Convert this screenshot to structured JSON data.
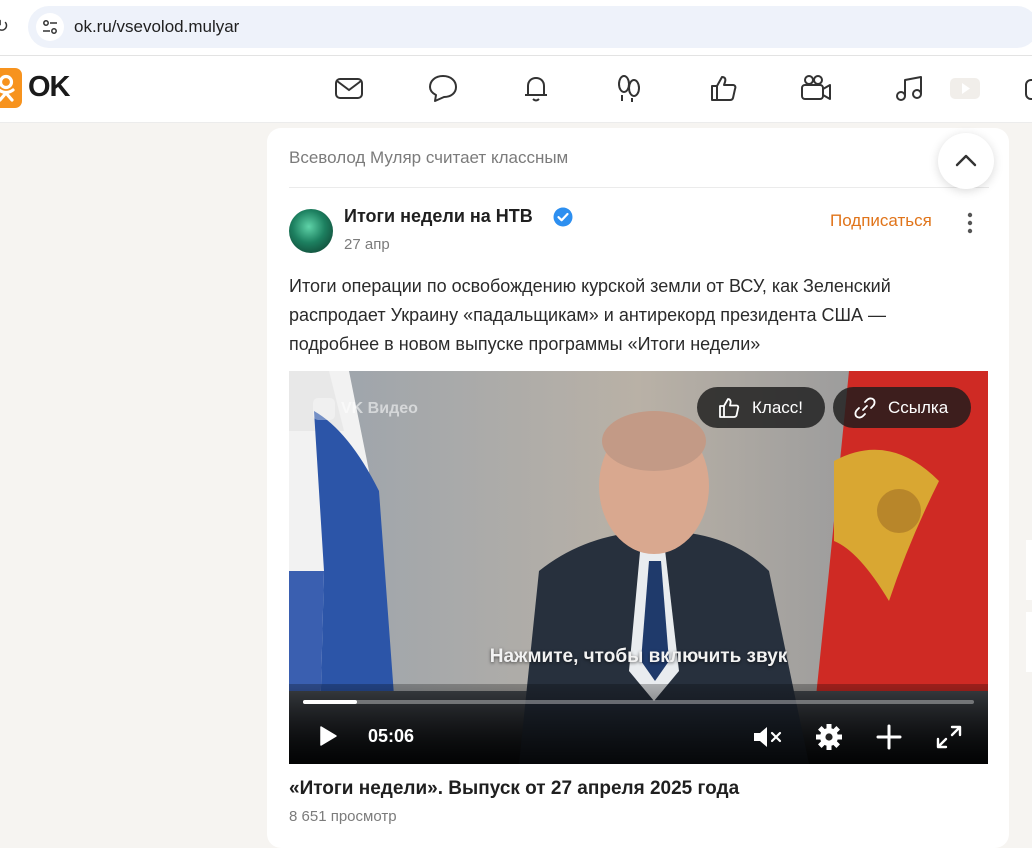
{
  "browser": {
    "url": "ok.ru/vsevolod.mulyar"
  },
  "header": {
    "logo_text": "OK",
    "brand_color": "#f7931e",
    "nav_icons": [
      "mail-icon",
      "chat-icon",
      "bell-icon",
      "guests-icon",
      "likes-icon",
      "video-camera-icon",
      "music-icon",
      "video-play-icon",
      "games-icon"
    ]
  },
  "post": {
    "liked_by": "Всеволод Муляр считает классным",
    "group_name": "Итоги недели на НТВ",
    "date": "27 апр",
    "subscribe_label": "Подписаться",
    "subscribe_color": "#e0741a",
    "text_lines": [
      "Итоги операции по освобождению курской земли от ВСУ, как Зеленский",
      "распродает Украину «падальщикам» и антирекорд президента США —",
      "подробнее в новом выпуске программы «Итоги недели»"
    ],
    "video": {
      "source_label": "VK Видео",
      "like_label": "Класс!",
      "link_label": "Ссылка",
      "sound_hint": "Нажмите, чтобы включить звук",
      "duration": "05:06",
      "progress": 0.08,
      "title": "«Итоги недели». Выпуск от 27 апреля 2025 года",
      "views": "8 651 просмотр"
    }
  }
}
